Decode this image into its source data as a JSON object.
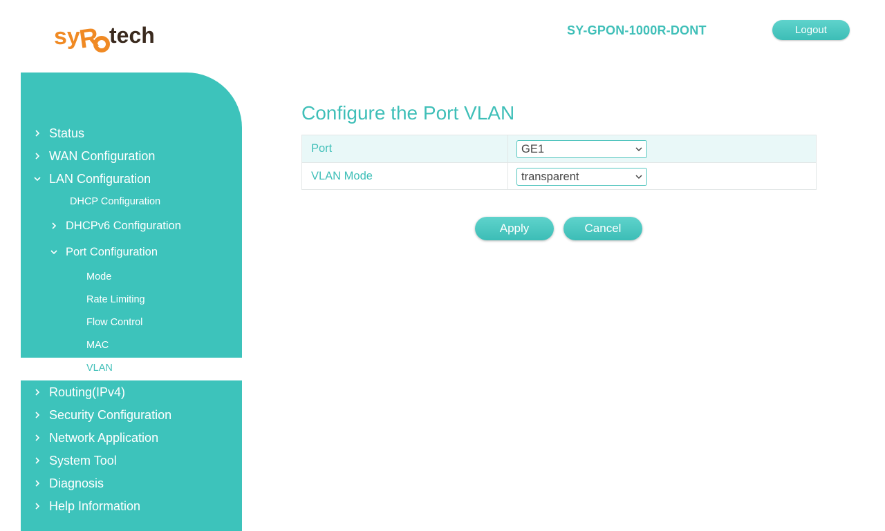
{
  "header": {
    "logo_text": "syRotech",
    "device_name": "SY-GPON-1000R-DONT",
    "logout_label": "Logout"
  },
  "sidebar": {
    "items": [
      {
        "label": "Status",
        "expanded": false
      },
      {
        "label": "WAN Configuration",
        "expanded": false
      },
      {
        "label": "LAN Configuration",
        "expanded": true
      },
      {
        "label": "DHCP Configuration"
      },
      {
        "label": "DHCPv6 Configuration",
        "expanded": false
      },
      {
        "label": "Port Configuration",
        "expanded": true
      },
      {
        "label": "Mode"
      },
      {
        "label": "Rate Limiting"
      },
      {
        "label": "Flow Control"
      },
      {
        "label": "MAC"
      },
      {
        "label": "VLAN",
        "active": true
      },
      {
        "label": "Routing(IPv4)",
        "expanded": false
      },
      {
        "label": "Security Configuration",
        "expanded": false
      },
      {
        "label": "Network Application",
        "expanded": false
      },
      {
        "label": "System Tool",
        "expanded": false
      },
      {
        "label": "Diagnosis",
        "expanded": false
      },
      {
        "label": "Help Information",
        "expanded": false
      }
    ]
  },
  "main": {
    "title": "Configure the Port VLAN",
    "fields": [
      {
        "label": "Port",
        "value": "GE1"
      },
      {
        "label": "VLAN Mode",
        "value": "transparent"
      }
    ],
    "apply_label": "Apply",
    "cancel_label": "Cancel"
  },
  "colors": {
    "accent": "#3fbfb8",
    "sidebar": "#3dc3bb",
    "logo_orange": "#f08a24",
    "logo_dark": "#3a2a1e"
  }
}
